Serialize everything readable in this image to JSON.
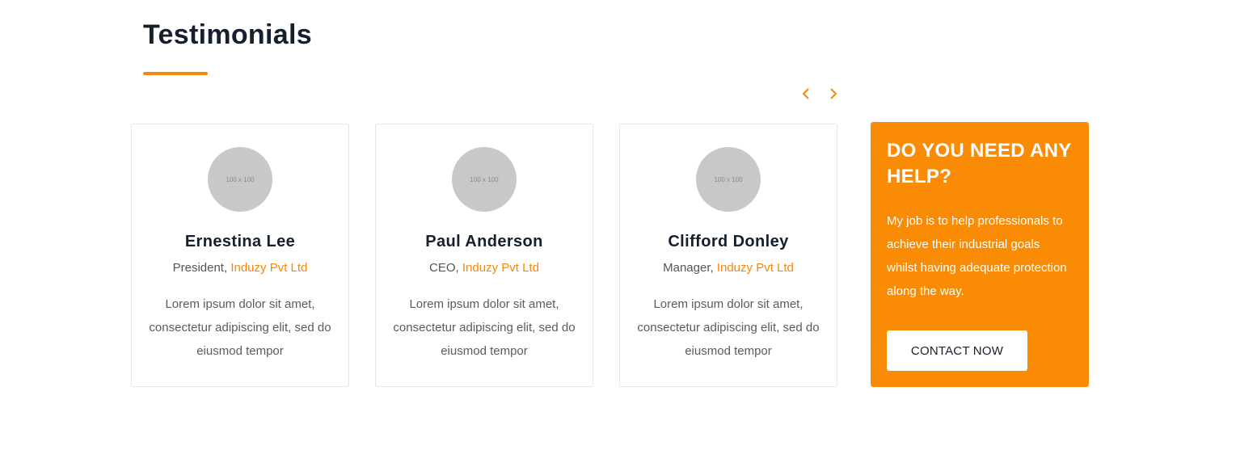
{
  "section": {
    "title": "Testimonials",
    "accent_color": "#f7870b"
  },
  "carousel": {
    "prev_icon": "chevron-left-icon",
    "next_icon": "chevron-right-icon"
  },
  "testimonials": [
    {
      "avatar_placeholder": "100 x 100",
      "name": "Ernestina Lee",
      "role": "President,",
      "company": "Induzy Pvt Ltd",
      "quote": "Lorem ipsum dolor sit amet, consectetur adipiscing elit, sed do eiusmod tempor"
    },
    {
      "avatar_placeholder": "100 x 100",
      "name": "Paul Anderson",
      "role": "CEO,",
      "company": "Induzy Pvt Ltd",
      "quote": "Lorem ipsum dolor sit amet, consectetur adipiscing elit, sed do eiusmod tempor"
    },
    {
      "avatar_placeholder": "100 x 100",
      "name": "Clifford Donley",
      "role": "Manager,",
      "company": "Induzy Pvt Ltd",
      "quote": "Lorem ipsum dolor sit amet, consectetur adipiscing elit, sed do eiusmod tempor"
    }
  ],
  "help": {
    "title": "DO YOU NEED ANY HELP?",
    "text": "My job is to help professionals to achieve their industrial goals whilst having adequate protection along the way.",
    "button_label": "CONTACT NOW",
    "background_color": "#fa8b04"
  }
}
